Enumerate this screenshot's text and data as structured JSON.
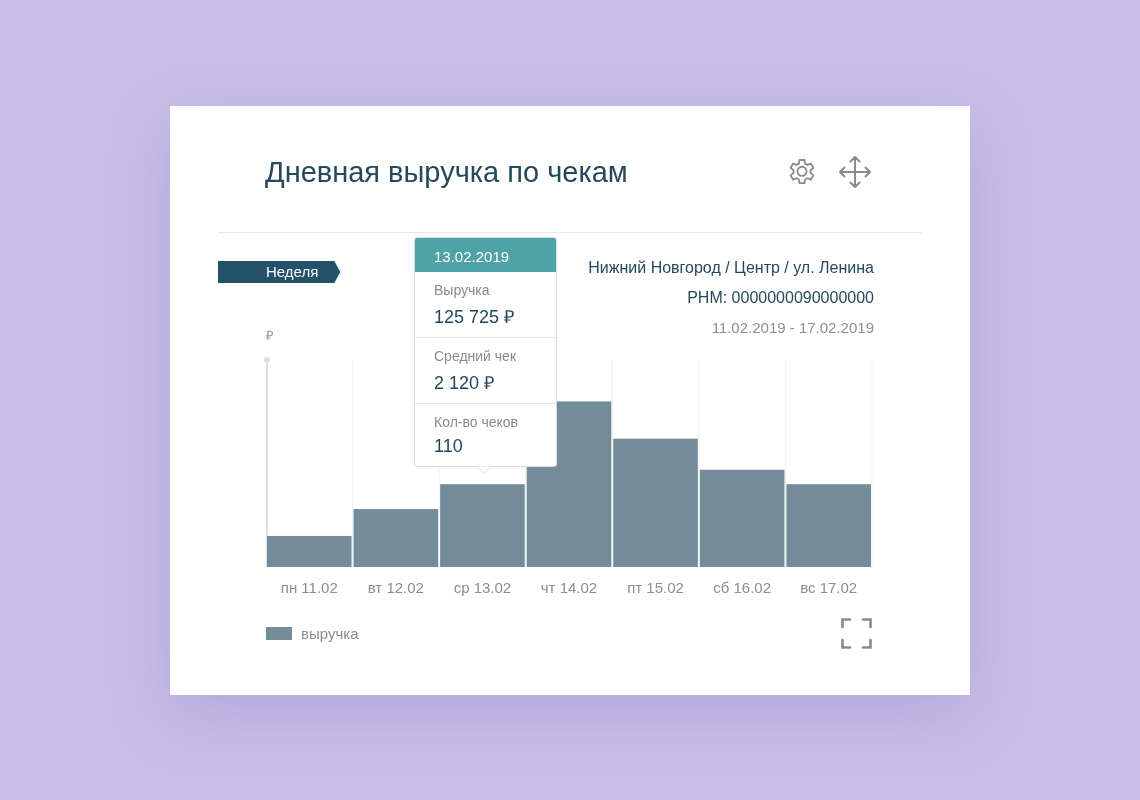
{
  "card": {
    "title": "Дневная выручка по чекам",
    "period_tag": "Неделя",
    "location": "Нижний Новгород / Центр / ул. Ленина",
    "register": "РНМ: 0000000090000000",
    "date_range": "11.02.2019 - 17.02.2019"
  },
  "chart": {
    "y_unit": "₽",
    "categories": [
      "пн 11.02",
      "вт 12.02",
      "ср 13.02",
      "чт 14.02",
      "пт 15.02",
      "сб 16.02",
      "вс 17.02"
    ],
    "legend": "выручка"
  },
  "tooltip": {
    "date": "13.02.2019",
    "fields": [
      {
        "label": "Выручка",
        "value": "125 725 ₽"
      },
      {
        "label": "Средний чек",
        "value": "2 120 ₽"
      },
      {
        "label": "Кол-во чеков",
        "value": "110"
      }
    ]
  }
}
